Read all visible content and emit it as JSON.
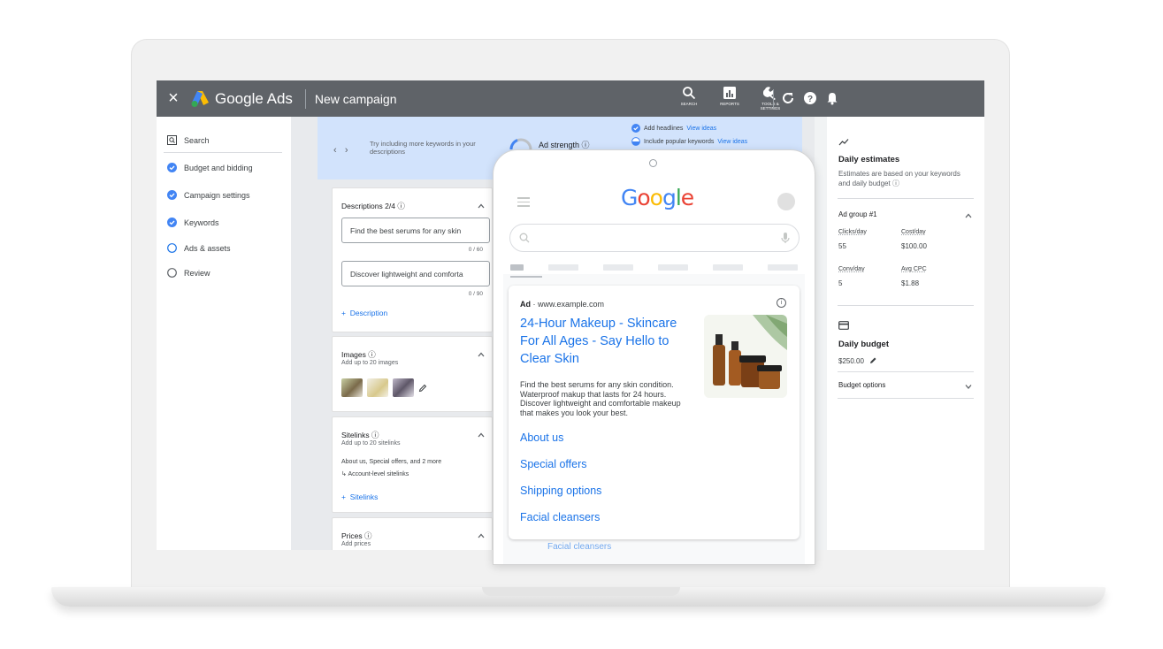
{
  "colors": {
    "topbar": "#5f6368",
    "accent": "#1a73e8",
    "banner": "#d2e3fc"
  },
  "topbar": {
    "brand": "Google Ads",
    "title": "New campaign",
    "tools": [
      {
        "label": "SEARCH",
        "icon": "search-icon"
      },
      {
        "label": "REPORTS",
        "icon": "reports-icon"
      },
      {
        "label": "TOOLS & SETTINGS",
        "icon": "wrench-icon"
      }
    ]
  },
  "nav": {
    "search": "Search",
    "items": [
      {
        "label": "Budget and bidding",
        "state": "done"
      },
      {
        "label": "Campaign settings",
        "state": "done"
      },
      {
        "label": "Keywords",
        "state": "done"
      },
      {
        "label": "Ads & assets",
        "state": "current"
      },
      {
        "label": "Review",
        "state": "todo"
      }
    ]
  },
  "banner": {
    "tip": "Try including more keywords in your descriptions",
    "ad_strength": "Ad strength",
    "suggestions": [
      {
        "text": "Add headlines",
        "link": "View ideas"
      },
      {
        "text": "Include popular keywords",
        "link": "View ideas"
      }
    ]
  },
  "descriptions": {
    "title": "Descriptions 2/4",
    "fields": [
      {
        "value": "Find the best serums for any skin",
        "counter": "0 / 60"
      },
      {
        "value": "Discover lightweight and comforta",
        "counter": "0 / 90"
      }
    ],
    "add": "Description"
  },
  "images": {
    "title": "Images",
    "subtitle": "Add up to 20 images"
  },
  "sitelinks": {
    "title": "Sitelinks",
    "subtitle": "Add up to 20 sitelinks",
    "summary": "About us, Special offers, and 2 more",
    "account_level": "Account-level sitelinks",
    "add": "Sitelinks"
  },
  "prices": {
    "title": "Prices",
    "subtitle": "Add prices"
  },
  "estimates": {
    "title": "Daily estimates",
    "subtitle": "Estimates are based on your keywords and daily budget",
    "group": "Ad group #1",
    "metrics": [
      {
        "label": "Clicks/day",
        "value": "55"
      },
      {
        "label": "Cost/day",
        "value": "$100.00"
      },
      {
        "label": "Conv/day",
        "value": "5"
      },
      {
        "label": "Avg CPC",
        "value": "$1.88"
      }
    ]
  },
  "budget": {
    "title": "Daily budget",
    "value": "$250.00",
    "options": "Budget options"
  },
  "preview": {
    "ad_label": "Ad",
    "url": "· www.example.com",
    "headline": "24-Hour Makeup - Skincare For All Ages  -  Say Hello to Clear Skin",
    "description": "Find the best serums for any skin condition. Waterproof makup that lasts for 24 hours. Discover lightweight and comfortable makeup that makes you look your best.",
    "sitelinks": [
      "About us",
      "Special offers",
      "Shipping options",
      "Facial cleansers"
    ],
    "peek_link": "Facial cleansers"
  }
}
